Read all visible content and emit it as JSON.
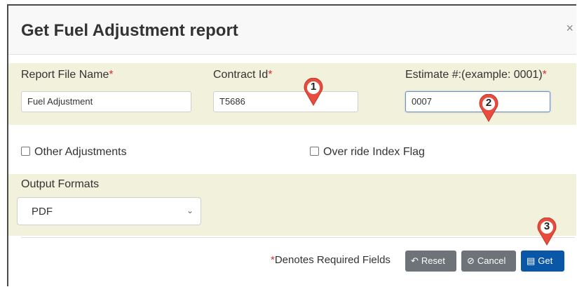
{
  "dialog": {
    "title": "Get Fuel Adjustment report",
    "close": "×"
  },
  "fields": {
    "report_file_name": {
      "label": "Report File Name",
      "required_mark": "*",
      "value": "Fuel Adjustment"
    },
    "contract_id": {
      "label": "Contract Id",
      "required_mark": "*",
      "value": "T5686"
    },
    "estimate": {
      "label": "Estimate #:(example: 0001)",
      "required_mark": "*",
      "value": "0007"
    }
  },
  "checkboxes": {
    "other_adjustments": {
      "label": "Other Adjustments",
      "checked": false
    },
    "override_index_flag": {
      "label": "Over ride Index Flag",
      "checked": false
    }
  },
  "output_formats": {
    "label": "Output Formats",
    "selected": "PDF"
  },
  "footer": {
    "required_mark": "*",
    "note": "Denotes Required Fields",
    "reset_label": "Reset",
    "cancel_label": "Cancel",
    "get_label": "Get"
  },
  "annotations": [
    {
      "number": "1",
      "color": "#e74c3c"
    },
    {
      "number": "2",
      "color": "#e74c3c"
    },
    {
      "number": "3",
      "color": "#e74c3c"
    }
  ],
  "colors": {
    "band": "#f2f1dc",
    "required": "#d32f2f",
    "button_gray": "#6d7378",
    "button_blue": "#0a57a8"
  }
}
